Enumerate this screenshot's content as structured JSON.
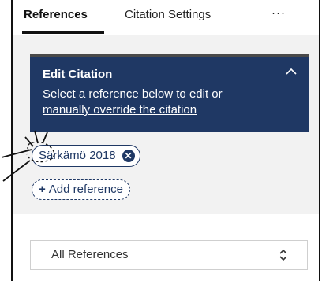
{
  "tabs": {
    "references": "References",
    "citation_settings": "Citation Settings",
    "more": "···"
  },
  "edit_citation": {
    "title": "Edit Citation",
    "description": "Select a reference below to edit or",
    "override_link": "manually override the citation",
    "collapse_icon": "chevron-up-icon"
  },
  "citation_chip": {
    "label": "Särkämö 2018",
    "remove_icon": "close-circle-icon"
  },
  "add_reference": {
    "label": "Add reference",
    "plus": "+"
  },
  "filter_select": {
    "value": "All References",
    "icon": "up-down-chevron-icon"
  },
  "colors": {
    "accent": "#1f3864",
    "panel_bg": "#f2f2f2"
  }
}
